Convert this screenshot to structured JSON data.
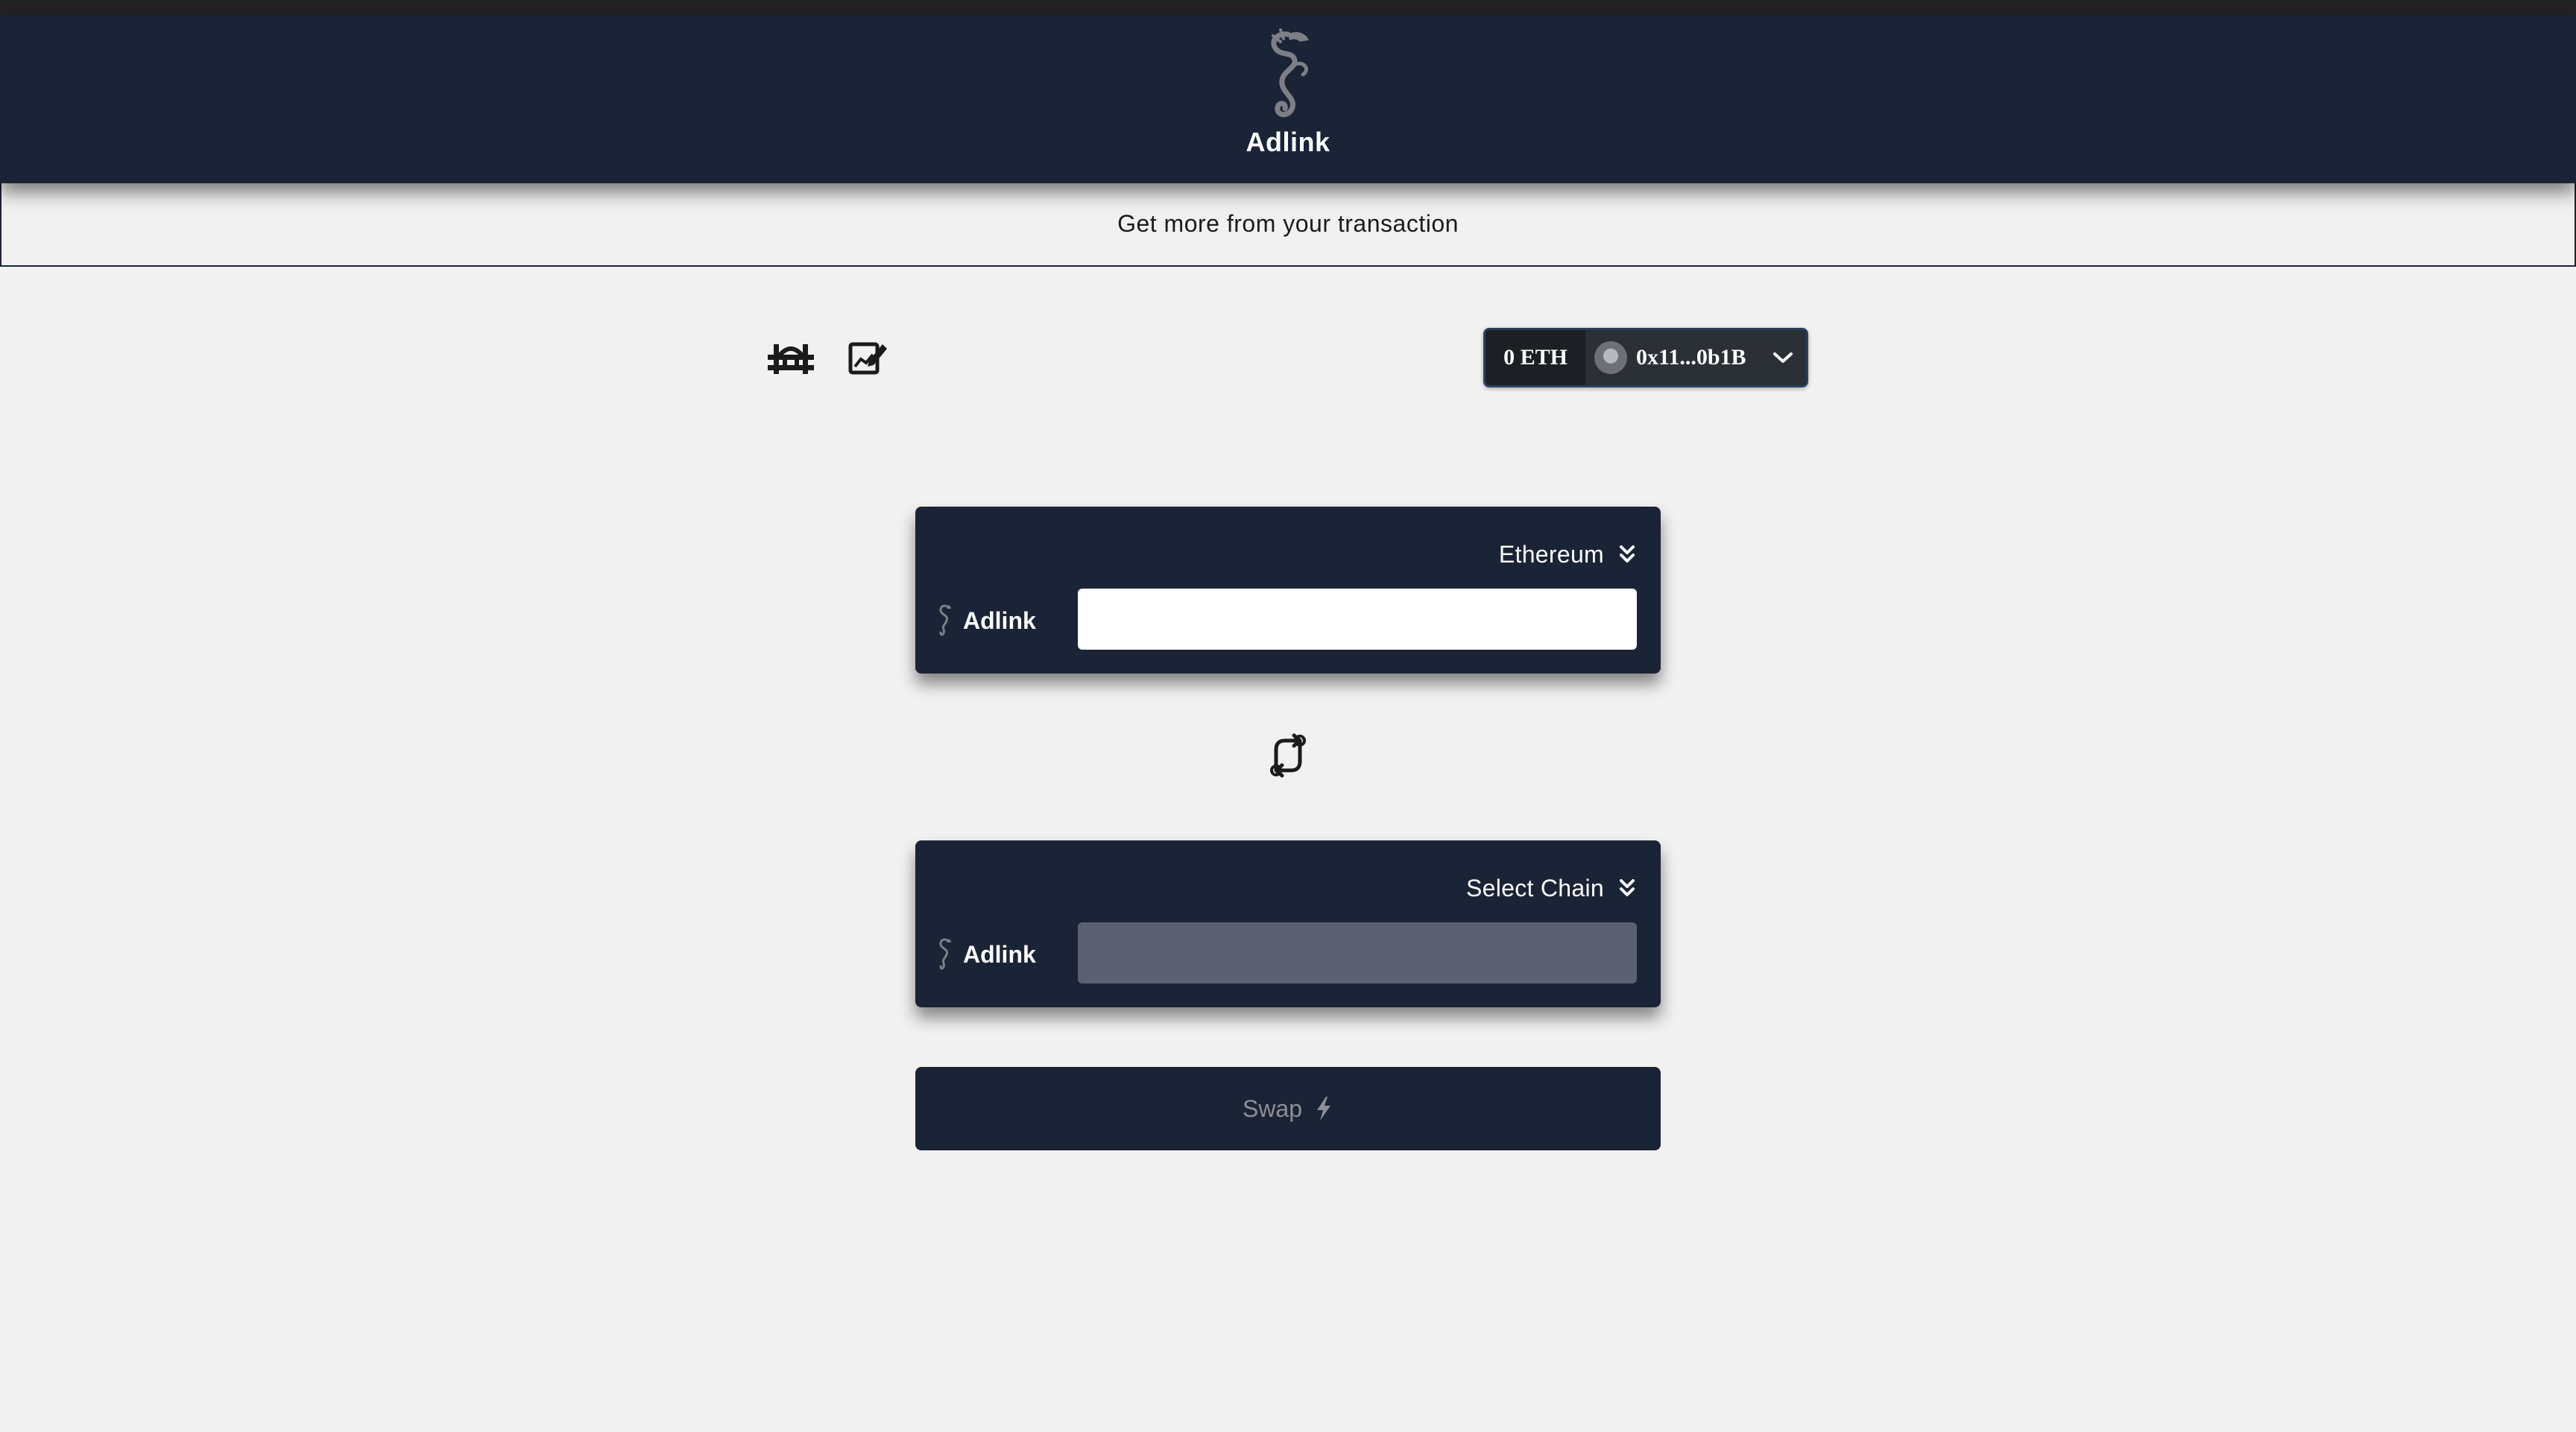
{
  "header": {
    "app_name": "Adlink",
    "logo_icon": "seahorse-icon"
  },
  "tagline": "Get more from your transaction",
  "toolbar": {
    "bridge_icon": "bridge-icon",
    "edit_icon": "edit-chart-icon"
  },
  "wallet": {
    "balance": "0 ETH",
    "address": "0x11...0b1B"
  },
  "source": {
    "chain": "Ethereum",
    "token": "Adlink",
    "amount": ""
  },
  "destination": {
    "chain": "Select Chain",
    "token": "Adlink",
    "amount": ""
  },
  "swap": {
    "label": "Swap"
  },
  "colors": {
    "navy": "#1b2436",
    "background": "#f2f1f1",
    "disabled_input": "#5b6170"
  }
}
